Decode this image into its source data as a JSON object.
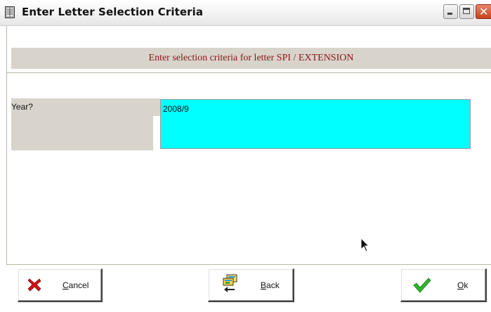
{
  "window": {
    "title": "Enter Letter Selection Criteria"
  },
  "banner": {
    "text": "Enter selection criteria for letter SPI / EXTENSION"
  },
  "fields": [
    {
      "label": "Year?",
      "value": "2008/9"
    }
  ],
  "buttons": {
    "cancel": {
      "mnemonic": "C",
      "rest": "ancel",
      "icon": "red-x-icon"
    },
    "back": {
      "mnemonic": "B",
      "rest": "ack",
      "icon": "folders-back-arrow-icon"
    },
    "ok": {
      "mnemonic": "O",
      "rest": "k",
      "icon": "green-checkmark-icon"
    }
  },
  "colors": {
    "input_background": "#00ffff",
    "banner_text": "#8b1414",
    "panel_gray": "#d8d4cc"
  }
}
